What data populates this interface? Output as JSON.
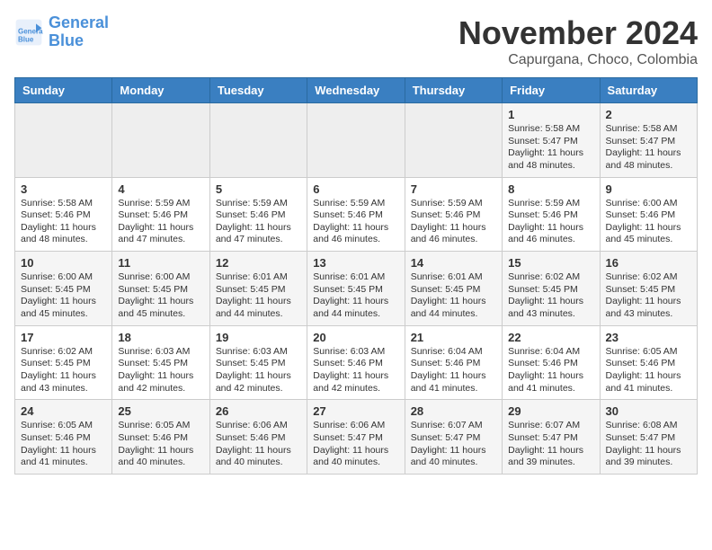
{
  "header": {
    "logo_line1": "General",
    "logo_line2": "Blue",
    "month_title": "November 2024",
    "subtitle": "Capurgana, Choco, Colombia"
  },
  "weekdays": [
    "Sunday",
    "Monday",
    "Tuesday",
    "Wednesday",
    "Thursday",
    "Friday",
    "Saturday"
  ],
  "weeks": [
    [
      {
        "day": "",
        "info": ""
      },
      {
        "day": "",
        "info": ""
      },
      {
        "day": "",
        "info": ""
      },
      {
        "day": "",
        "info": ""
      },
      {
        "day": "",
        "info": ""
      },
      {
        "day": "1",
        "info": "Sunrise: 5:58 AM\nSunset: 5:47 PM\nDaylight: 11 hours and 48 minutes."
      },
      {
        "day": "2",
        "info": "Sunrise: 5:58 AM\nSunset: 5:47 PM\nDaylight: 11 hours and 48 minutes."
      }
    ],
    [
      {
        "day": "3",
        "info": "Sunrise: 5:58 AM\nSunset: 5:46 PM\nDaylight: 11 hours and 48 minutes."
      },
      {
        "day": "4",
        "info": "Sunrise: 5:59 AM\nSunset: 5:46 PM\nDaylight: 11 hours and 47 minutes."
      },
      {
        "day": "5",
        "info": "Sunrise: 5:59 AM\nSunset: 5:46 PM\nDaylight: 11 hours and 47 minutes."
      },
      {
        "day": "6",
        "info": "Sunrise: 5:59 AM\nSunset: 5:46 PM\nDaylight: 11 hours and 46 minutes."
      },
      {
        "day": "7",
        "info": "Sunrise: 5:59 AM\nSunset: 5:46 PM\nDaylight: 11 hours and 46 minutes."
      },
      {
        "day": "8",
        "info": "Sunrise: 5:59 AM\nSunset: 5:46 PM\nDaylight: 11 hours and 46 minutes."
      },
      {
        "day": "9",
        "info": "Sunrise: 6:00 AM\nSunset: 5:46 PM\nDaylight: 11 hours and 45 minutes."
      }
    ],
    [
      {
        "day": "10",
        "info": "Sunrise: 6:00 AM\nSunset: 5:45 PM\nDaylight: 11 hours and 45 minutes."
      },
      {
        "day": "11",
        "info": "Sunrise: 6:00 AM\nSunset: 5:45 PM\nDaylight: 11 hours and 45 minutes."
      },
      {
        "day": "12",
        "info": "Sunrise: 6:01 AM\nSunset: 5:45 PM\nDaylight: 11 hours and 44 minutes."
      },
      {
        "day": "13",
        "info": "Sunrise: 6:01 AM\nSunset: 5:45 PM\nDaylight: 11 hours and 44 minutes."
      },
      {
        "day": "14",
        "info": "Sunrise: 6:01 AM\nSunset: 5:45 PM\nDaylight: 11 hours and 44 minutes."
      },
      {
        "day": "15",
        "info": "Sunrise: 6:02 AM\nSunset: 5:45 PM\nDaylight: 11 hours and 43 minutes."
      },
      {
        "day": "16",
        "info": "Sunrise: 6:02 AM\nSunset: 5:45 PM\nDaylight: 11 hours and 43 minutes."
      }
    ],
    [
      {
        "day": "17",
        "info": "Sunrise: 6:02 AM\nSunset: 5:45 PM\nDaylight: 11 hours and 43 minutes."
      },
      {
        "day": "18",
        "info": "Sunrise: 6:03 AM\nSunset: 5:45 PM\nDaylight: 11 hours and 42 minutes."
      },
      {
        "day": "19",
        "info": "Sunrise: 6:03 AM\nSunset: 5:45 PM\nDaylight: 11 hours and 42 minutes."
      },
      {
        "day": "20",
        "info": "Sunrise: 6:03 AM\nSunset: 5:46 PM\nDaylight: 11 hours and 42 minutes."
      },
      {
        "day": "21",
        "info": "Sunrise: 6:04 AM\nSunset: 5:46 PM\nDaylight: 11 hours and 41 minutes."
      },
      {
        "day": "22",
        "info": "Sunrise: 6:04 AM\nSunset: 5:46 PM\nDaylight: 11 hours and 41 minutes."
      },
      {
        "day": "23",
        "info": "Sunrise: 6:05 AM\nSunset: 5:46 PM\nDaylight: 11 hours and 41 minutes."
      }
    ],
    [
      {
        "day": "24",
        "info": "Sunrise: 6:05 AM\nSunset: 5:46 PM\nDaylight: 11 hours and 41 minutes."
      },
      {
        "day": "25",
        "info": "Sunrise: 6:05 AM\nSunset: 5:46 PM\nDaylight: 11 hours and 40 minutes."
      },
      {
        "day": "26",
        "info": "Sunrise: 6:06 AM\nSunset: 5:46 PM\nDaylight: 11 hours and 40 minutes."
      },
      {
        "day": "27",
        "info": "Sunrise: 6:06 AM\nSunset: 5:47 PM\nDaylight: 11 hours and 40 minutes."
      },
      {
        "day": "28",
        "info": "Sunrise: 6:07 AM\nSunset: 5:47 PM\nDaylight: 11 hours and 40 minutes."
      },
      {
        "day": "29",
        "info": "Sunrise: 6:07 AM\nSunset: 5:47 PM\nDaylight: 11 hours and 39 minutes."
      },
      {
        "day": "30",
        "info": "Sunrise: 6:08 AM\nSunset: 5:47 PM\nDaylight: 11 hours and 39 minutes."
      }
    ]
  ]
}
